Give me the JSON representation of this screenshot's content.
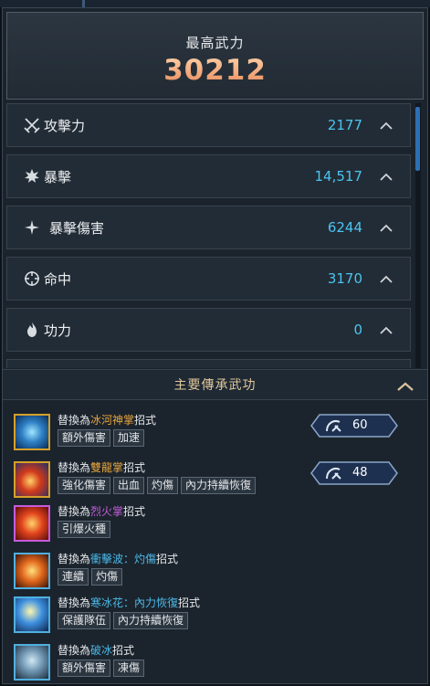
{
  "power": {
    "label": "最高武力",
    "value": "30212"
  },
  "stats": [
    {
      "name": "攻擊力",
      "value": "2177",
      "icon": "crossed-swords-icon"
    },
    {
      "name": "暴擊",
      "value": "14,517",
      "icon": "burst-icon"
    },
    {
      "name": "暴擊傷害",
      "value": "6244",
      "icon": "sparkle-icon"
    },
    {
      "name": "命中",
      "value": "3170",
      "icon": "crosshair-icon"
    },
    {
      "name": "功力",
      "value": "0",
      "icon": "flame-icon"
    }
  ],
  "section": {
    "title": "主要傳承武功"
  },
  "skills": [
    {
      "prefix": "替換為",
      "name": "冰河神掌",
      "suffix": "招式",
      "name_color": "#e8a53c",
      "tags": [
        "額外傷害",
        "加速"
      ],
      "icon": "ice-palm-icon",
      "badge": "60"
    },
    {
      "prefix": "替換為",
      "name": "雙龍掌",
      "suffix": "招式",
      "name_color": "#e8a53c",
      "tags": [
        "強化傷害",
        "出血",
        "灼傷",
        "內力持續恢復"
      ],
      "icon": "dragon-palm-icon",
      "badge": "48"
    },
    {
      "prefix": "替換為",
      "name": "烈火掌",
      "suffix": "招式",
      "name_color": "#c65bdc",
      "tags": [
        "引爆火種"
      ],
      "icon": "fire-palm-icon"
    },
    {
      "prefix": "替換為",
      "name": "衝擊波：灼傷",
      "suffix": "招式",
      "name_color": "#4cb8e8",
      "tags": [
        "連續",
        "灼傷"
      ],
      "icon": "shockwave-icon"
    },
    {
      "prefix": "替換為",
      "name": "寒冰花：內力恢復",
      "suffix": "招式",
      "name_color": "#4cb8e8",
      "tags": [
        "保護隊伍",
        "內力持續恢復"
      ],
      "icon": "frost-flower-icon"
    },
    {
      "prefix": "替換為",
      "name": "破冰",
      "suffix": "招式",
      "name_color": "#4cb8e8",
      "tags": [
        "額外傷害",
        "凍傷"
      ],
      "icon": "ice-break-icon"
    }
  ]
}
